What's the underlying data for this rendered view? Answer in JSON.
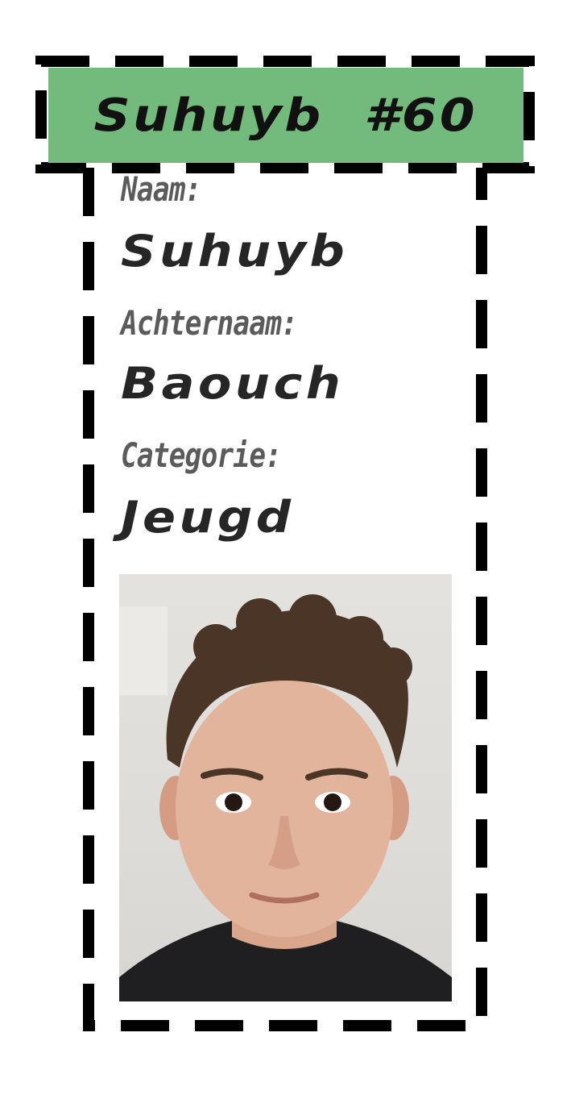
{
  "header": {
    "title": "Suhuyb  #60"
  },
  "fields": {
    "first_name_label": "Naam:",
    "first_name_value": "Suhuyb",
    "last_name_label": "Achternaam:",
    "last_name_value": "Baouch",
    "category_label": "Categorie:",
    "category_value": "Jeugd"
  },
  "colors": {
    "header_background": "#72bb7c",
    "frame": "#000000",
    "label_text": "#5b5b5b",
    "value_text": "#262626"
  },
  "photo": {
    "subject": "player-portrait"
  }
}
